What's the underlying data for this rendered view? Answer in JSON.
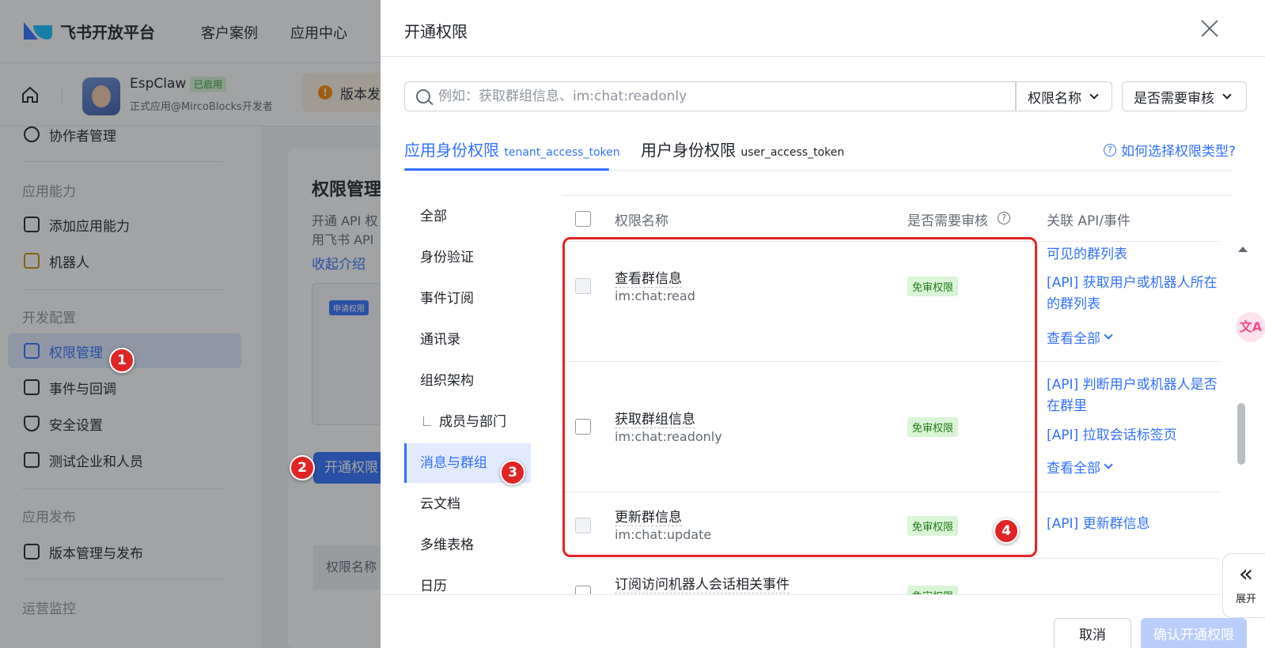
{
  "background_app": {
    "logo_text": "飞书开放平台",
    "top_nav": [
      "客户案例",
      "应用中心"
    ],
    "app": {
      "name": "EspClaw",
      "status": "已启用",
      "subtitle": "正式应用@MircoBlocks开发者"
    },
    "version_banner": "版本发",
    "sidebar": {
      "top_item": "协作者管理",
      "groups": [
        {
          "label": "应用能力",
          "items": [
            "添加应用能力",
            "机器人"
          ]
        },
        {
          "label": "开发配置",
          "items": [
            "权限管理",
            "事件与回调",
            "安全设置",
            "测试企业和人员"
          ]
        },
        {
          "label": "应用发布",
          "items": [
            "版本管理与发布"
          ]
        },
        {
          "label": "运营监控",
          "items": []
        }
      ],
      "active_item": "权限管理"
    },
    "content": {
      "title": "权限管理",
      "desc_line1": "开通 API 权",
      "desc_line2": "用飞书 API",
      "collapse_link": "收起介绍",
      "apply_tag": "申请权限",
      "open_button": "开通权限",
      "table_head": "权限名称"
    }
  },
  "drawer": {
    "title": "开通权限",
    "search_placeholder": "例如：获取群组信息、im:chat:readonly",
    "filter_name": "权限名称",
    "filter_review": "是否需要审核",
    "tabs": [
      {
        "label": "应用身份权限",
        "token": "tenant_access_token",
        "active": true
      },
      {
        "label": "用户身份权限",
        "token": "user_access_token",
        "active": false
      }
    ],
    "help_link": "如何选择权限类型?",
    "categories": [
      "全部",
      "身份验证",
      "事件订阅",
      "通讯录",
      "组织架构",
      "成员与部门",
      "消息与群组",
      "云文档",
      "多维表格",
      "日历"
    ],
    "active_category": "消息与群组",
    "table_headers": {
      "name": "权限名称",
      "review": "是否需要审核",
      "api": "关联 API/事件"
    },
    "rows": [
      {
        "name": "查看群信息",
        "code": "im:chat:read",
        "review": "免审权限",
        "apis": [
          "可见的群列表",
          "[API] 获取用户或机器人所在的群列表"
        ],
        "more": "查看全部",
        "checkbox_disabled": true
      },
      {
        "name": "获取群组信息",
        "code": "im:chat:readonly",
        "review": "免审权限",
        "apis": [
          "[API] 判断用户或机器人是否在群里",
          "[API] 拉取会话标签页"
        ],
        "more": "查看全部",
        "checkbox_disabled": false
      },
      {
        "name": "更新群信息",
        "code": "im:chat:update",
        "review": "免审权限",
        "apis": [
          "[API] 更新群信息"
        ],
        "checkbox_disabled": true
      },
      {
        "name": "订阅访问机器人会话相关事件",
        "code": "",
        "review": "免审权限",
        "apis": [],
        "checkbox_disabled": false
      }
    ],
    "cancel_button": "取消",
    "confirm_button": "确认开通权限",
    "expand_label": "展开",
    "translate_icon_text": "文A"
  },
  "annotations": [
    "1",
    "2",
    "3",
    "4"
  ],
  "colors": {
    "brand": "#3370ff",
    "annotation_red": "#e02424",
    "badge_green_bg": "#d9f5d6"
  }
}
